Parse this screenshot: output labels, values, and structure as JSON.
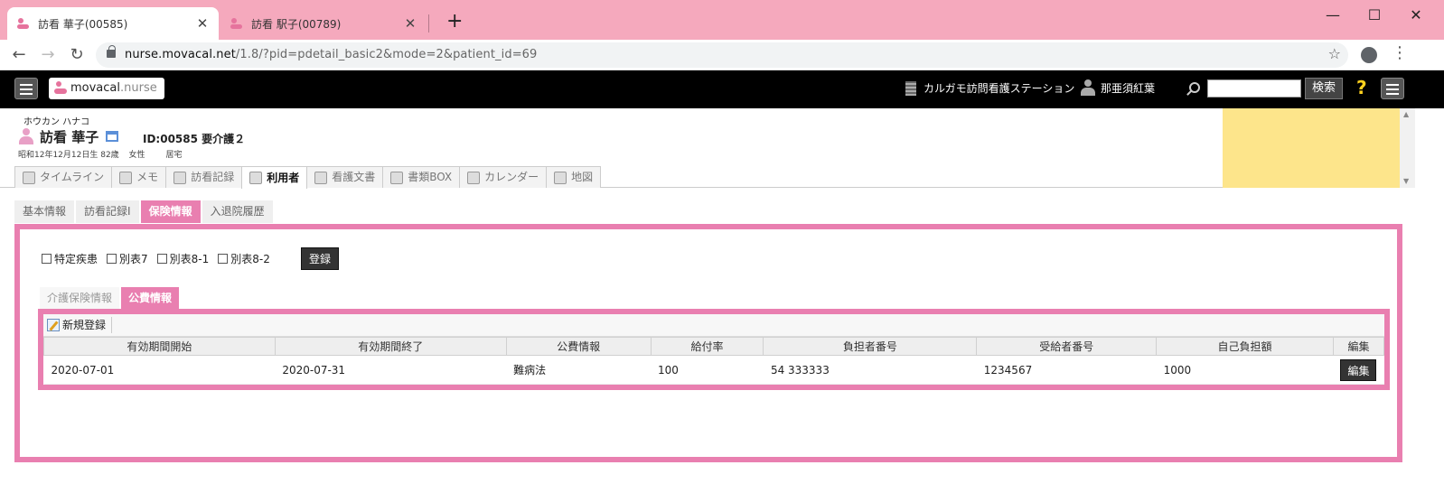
{
  "browser": {
    "tabs": [
      {
        "title": "訪看 華子(00585)",
        "active": true
      },
      {
        "title": "訪看 駅子(00789)",
        "active": false
      }
    ],
    "new_tab": "+",
    "close": "✕",
    "window": {
      "minimize": "—",
      "maximize": "☐",
      "close": "✕"
    },
    "url_host": "nurse.movacal.net",
    "url_path": "/1.8/?pid=pdetail_basic2&mode=2&patient_id=69"
  },
  "app": {
    "logo_main": "movacal",
    "logo_sub": ".nurse",
    "station": "カルガモ訪問看護ステーション",
    "user": "那亜須紅葉",
    "search_placeholder": "",
    "search_button": "検索",
    "help": "?"
  },
  "patient": {
    "kana": "ホウカン ハナコ",
    "name": "訪看 華子",
    "id_care": "ID:00585 要介護２",
    "birth": "昭和12年12月12日生 82歳",
    "sex": "女性",
    "residence": "居宅",
    "tabs": [
      {
        "label": "タイムライン",
        "active": false
      },
      {
        "label": "メモ",
        "active": false
      },
      {
        "label": "訪看記録",
        "active": false
      },
      {
        "label": "利用者",
        "active": true
      },
      {
        "label": "看護文書",
        "active": false
      },
      {
        "label": "書類BOX",
        "active": false
      },
      {
        "label": "カレンダー",
        "active": false
      },
      {
        "label": "地図",
        "active": false
      }
    ]
  },
  "subtabs": [
    {
      "label": "基本情報",
      "active": false
    },
    {
      "label": "訪看記録Ⅰ",
      "active": false
    },
    {
      "label": "保険情報",
      "active": true
    },
    {
      "label": "入退院履歴",
      "active": false
    }
  ],
  "checks": [
    "特定疾患",
    "別表7",
    "別表8-1",
    "別表8-2"
  ],
  "register_button": "登録",
  "inner_tabs": [
    {
      "label": "介護保険情報",
      "active": false
    },
    {
      "label": "公費情報",
      "active": true
    }
  ],
  "table": {
    "new_button": "新規登録",
    "headers": [
      "有効期間開始",
      "有効期間終了",
      "公費情報",
      "給付率",
      "負担者番号",
      "受給者番号",
      "自己負担額",
      "編集"
    ],
    "rows": [
      [
        "2020-07-01",
        "2020-07-31",
        "難病法",
        "100",
        "54 333333",
        "1234567",
        "1000"
      ]
    ],
    "edit_button": "編集"
  }
}
